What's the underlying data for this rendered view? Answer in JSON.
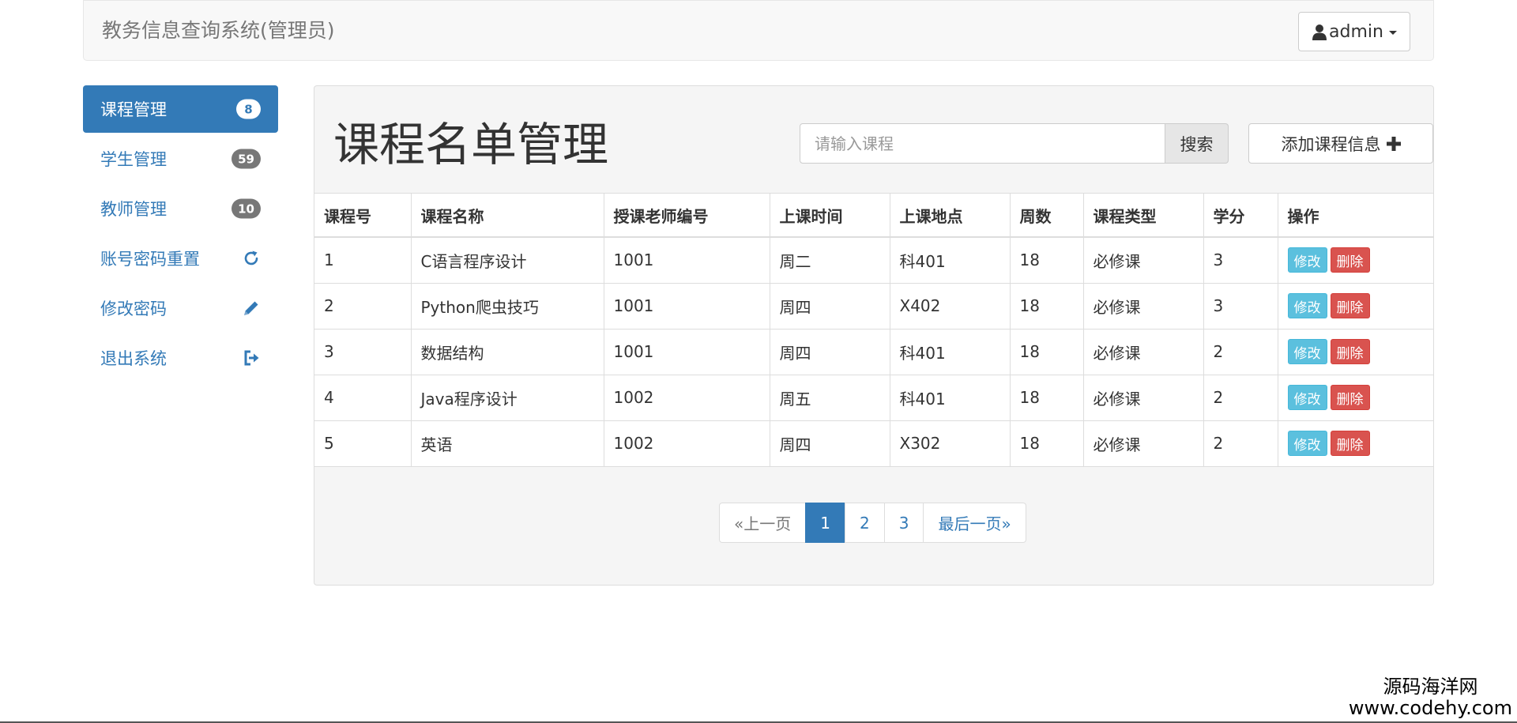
{
  "navbar": {
    "brand": "教务信息查询系统(管理员)",
    "user_label": "admin"
  },
  "sidebar": {
    "items": [
      {
        "label": "课程管理",
        "badge": "8",
        "active": true
      },
      {
        "label": "学生管理",
        "badge": "59"
      },
      {
        "label": "教师管理",
        "badge": "10"
      },
      {
        "label": "账号密码重置",
        "icon": "refresh-icon"
      },
      {
        "label": "修改密码",
        "icon": "pencil-icon"
      },
      {
        "label": "退出系统",
        "icon": "logout-icon"
      }
    ]
  },
  "main": {
    "title": "课程名单管理",
    "search_placeholder": "请输入课程",
    "search_label": "搜索",
    "add_label": "添加课程信息"
  },
  "table": {
    "columns": [
      "课程号",
      "课程名称",
      "授课老师编号",
      "上课时间",
      "上课地点",
      "周数",
      "课程类型",
      "学分",
      "操作"
    ],
    "edit_label": "修改",
    "delete_label": "删除",
    "rows": [
      [
        "1",
        "C语言程序设计",
        "1001",
        "周二",
        "科401",
        "18",
        "必修课",
        "3"
      ],
      [
        "2",
        "Python爬虫技巧",
        "1001",
        "周四",
        "X402",
        "18",
        "必修课",
        "3"
      ],
      [
        "3",
        "数据结构",
        "1001",
        "周四",
        "科401",
        "18",
        "必修课",
        "2"
      ],
      [
        "4",
        "Java程序设计",
        "1002",
        "周五",
        "科401",
        "18",
        "必修课",
        "2"
      ],
      [
        "5",
        "英语",
        "1002",
        "周四",
        "X302",
        "18",
        "必修课",
        "2"
      ]
    ]
  },
  "pagination": {
    "prev": "«上一页",
    "pages": [
      "1",
      "2",
      "3"
    ],
    "current": "1",
    "last": "最后一页»"
  },
  "watermark": {
    "line1": "源码海洋网",
    "line2": "www.codehy.com"
  },
  "colors": {
    "primary": "#337ab7",
    "info": "#5bc0de",
    "danger": "#d9534f",
    "badge": "#777777"
  }
}
